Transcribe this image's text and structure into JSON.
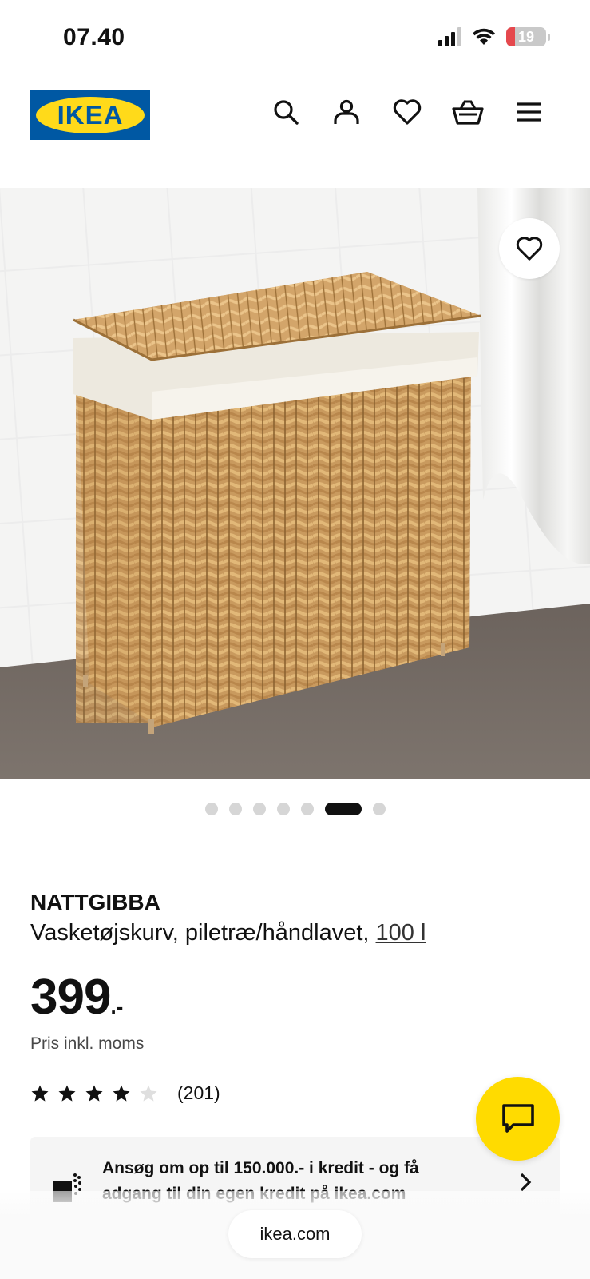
{
  "status_bar": {
    "time": "07.40",
    "battery": "19"
  },
  "header": {
    "logo_text": "IKEA",
    "icons": [
      "search-icon",
      "user-icon",
      "heart-icon",
      "basket-icon",
      "menu-icon"
    ]
  },
  "carousel": {
    "dot_count": 7,
    "active_index": 5
  },
  "product": {
    "name": "NATTGIBBA",
    "description": "Vasketøjskurv, piletræ/håndlavet, ",
    "size_link": "100 l",
    "price": "399",
    "price_suffix": ".-",
    "price_note": "Pris inkl. moms",
    "rating_value": 4,
    "rating_max": 5,
    "rating_count": "(201)"
  },
  "credit_banner": {
    "text": "Ansøg om op til 150.000.- i kredit - og få adgang til din egen kredit på ikea.com"
  },
  "browser": {
    "url": "ikea.com"
  },
  "colors": {
    "ikea_blue": "#0058a3",
    "ikea_yellow": "#ffda1a",
    "chat_yellow": "#ffdb00",
    "battery_low": "#e5484d"
  }
}
